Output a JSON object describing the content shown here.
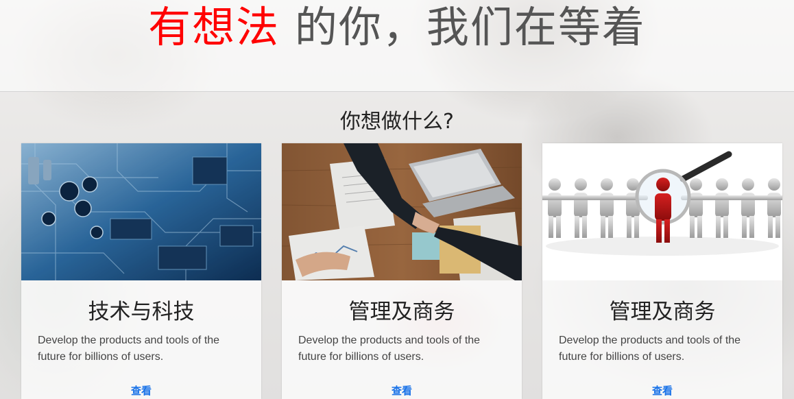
{
  "hero": {
    "highlight": "有想法",
    "rest": "的你，我们在等着",
    "highlight_color": "#ff0000"
  },
  "section": {
    "title": "你想做什么?"
  },
  "cards": [
    {
      "image_icon": "circuit-board-photo",
      "title": "技术与科技",
      "description": "Develop the products and tools of the future for billions of users.",
      "link_label": "查看"
    },
    {
      "image_icon": "business-handshake-photo",
      "title": "管理及商务",
      "description": "Develop the products and tools of the future for billions of users.",
      "link_label": "查看"
    },
    {
      "image_icon": "recruitment-magnifier-photo",
      "title": "管理及商务",
      "description": "Develop the products and tools of the future for billions of users.",
      "link_label": "查看"
    }
  ],
  "colors": {
    "link": "#1a73e8",
    "title_text": "#222222"
  }
}
